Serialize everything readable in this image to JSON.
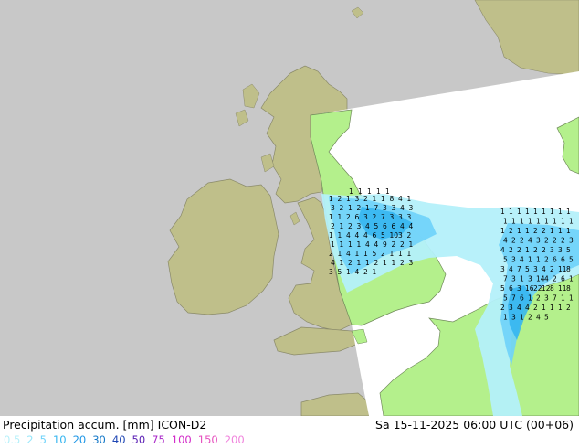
{
  "footer": {
    "title": "Precipitation accum. [mm] ICON-D2",
    "datetime": "Sa 15-11-2025 06:00 UTC (00+06)"
  },
  "legend": [
    {
      "label": "0.5",
      "color": "#b4f0fa"
    },
    {
      "label": "2",
      "color": "#96e6fa"
    },
    {
      "label": "5",
      "color": "#6ed2fa"
    },
    {
      "label": "10",
      "color": "#32b4f0"
    },
    {
      "label": "20",
      "color": "#1e96e6"
    },
    {
      "label": "30",
      "color": "#1478c8"
    },
    {
      "label": "40",
      "color": "#1e46b4"
    },
    {
      "label": "50",
      "color": "#5a1eb4"
    },
    {
      "label": "75",
      "color": "#aa28c8"
    },
    {
      "label": "100",
      "color": "#d228c8"
    },
    {
      "label": "150",
      "color": "#e650be"
    },
    {
      "label": "200",
      "color": "#f082dc"
    }
  ],
  "colors": {
    "sea": "#c8c8c8",
    "land_outside": "#bfbf8a",
    "land_domain": "#b4f08c",
    "sea_domain": "#ffffff",
    "precip_light": "#b4f0fa",
    "precip_medium": "#6ed2fa",
    "precip_heavy": "#32b4f0"
  },
  "precip_labels": {
    "west": [
      "1",
      "2",
      "1",
      "3",
      "2",
      "1",
      "1",
      "8",
      "4",
      "1",
      "3",
      "2",
      "1",
      "2",
      "1",
      "7",
      "3",
      "3",
      "4",
      "3",
      "1",
      "1",
      "2",
      "6",
      "3",
      "2",
      "7",
      "3",
      "3",
      "3",
      "2",
      "1",
      "2",
      "3",
      "4",
      "5",
      "6",
      "6",
      "4",
      "4",
      "1",
      "1",
      "4",
      "4",
      "4",
      "6",
      "5",
      "10",
      "3",
      "2",
      "1",
      "1",
      "1",
      "1",
      "4",
      "4",
      "9",
      "2",
      "2",
      "1",
      "2",
      "1",
      "4",
      "1",
      "1",
      "5",
      "2",
      "1",
      "1",
      "1",
      "4",
      "1",
      "2",
      "1",
      "1",
      "2",
      "1",
      "1",
      "2",
      "3",
      "3",
      "5",
      "1",
      "4",
      "2",
      "1"
    ],
    "east": [
      "1",
      "1",
      "1",
      "1",
      "1",
      "1",
      "1",
      "1",
      "1",
      "1",
      "1",
      "1",
      "1",
      "1",
      "1",
      "1",
      "1",
      "1",
      "1",
      "2",
      "1",
      "1",
      "2",
      "2",
      "1",
      "1",
      "1",
      "4",
      "2",
      "2",
      "4",
      "3",
      "2",
      "2",
      "2",
      "3",
      "4",
      "2",
      "2",
      "1",
      "2",
      "2",
      "3",
      "3",
      "5",
      "5",
      "3",
      "4",
      "1",
      "1",
      "2",
      "6",
      "6",
      "5",
      "3",
      "4",
      "7",
      "5",
      "3",
      "4",
      "2",
      "11",
      "8",
      "7",
      "3",
      "1",
      "3",
      "14",
      "4",
      "2",
      "6",
      "1",
      "5",
      "6",
      "3",
      "16",
      "22",
      "12",
      "8",
      "11",
      "8",
      "5",
      "7",
      "6",
      "1",
      "2",
      "3",
      "7",
      "1",
      "1",
      "2",
      "3",
      "4",
      "4",
      "2",
      "1",
      "1",
      "1",
      "2",
      "1",
      "3",
      "1",
      "2",
      "4",
      "5"
    ],
    "top": [
      "1",
      "1",
      "1",
      "1",
      "1"
    ]
  }
}
